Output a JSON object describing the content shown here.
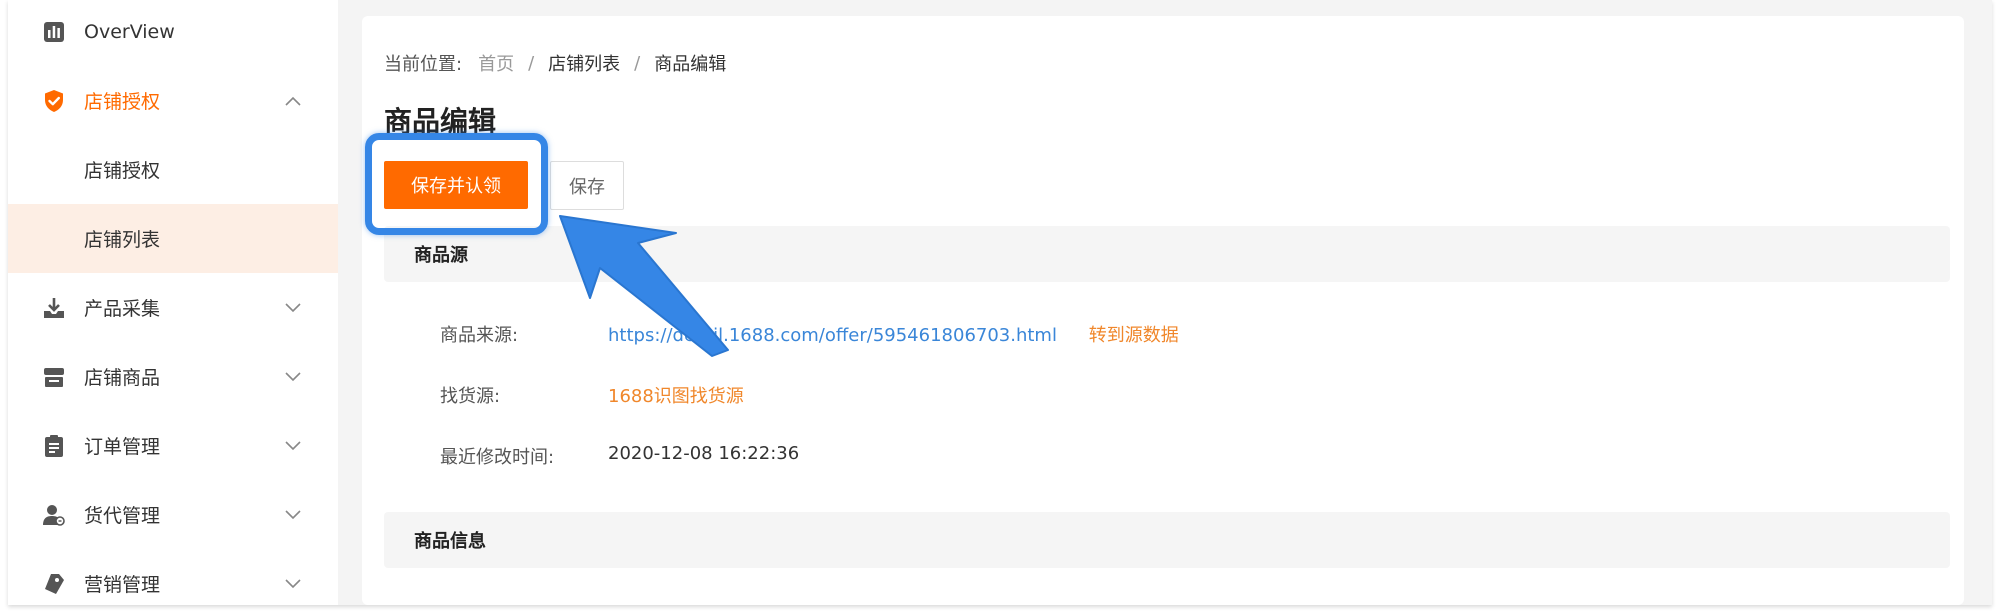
{
  "sidebar": {
    "items": [
      {
        "label": "OverView",
        "icon": "chart-bars-icon"
      },
      {
        "label": "店铺授权",
        "icon": "shield-check-icon"
      },
      {
        "label": "店铺授权",
        "icon": ""
      },
      {
        "label": "店铺列表",
        "icon": ""
      },
      {
        "label": "产品采集",
        "icon": "download-tray-icon"
      },
      {
        "label": "店铺商品",
        "icon": "store-icon"
      },
      {
        "label": "订单管理",
        "icon": "clipboard-icon"
      },
      {
        "label": "货代管理",
        "icon": "user-agent-icon"
      },
      {
        "label": "营销管理",
        "icon": "tag-icon"
      }
    ],
    "accent": "#ff6a00",
    "selected_bg": "#fdeee4"
  },
  "breadcrumb": {
    "prefix": "当前位置:",
    "items": [
      "首页",
      "店铺列表",
      "商品编辑"
    ],
    "separator": "/"
  },
  "page": {
    "title": "商品编辑"
  },
  "actions": {
    "primary_label": "保存并认领",
    "secondary_label": "保存"
  },
  "sections": {
    "source": {
      "title": "商品源",
      "fields": {
        "source_label": "商品来源:",
        "source_url": "https://detail.1688.com/offer/595461806703.html",
        "source_action": "转到源数据",
        "find_label": "找货源:",
        "find_link": "1688识图找货源",
        "modified_label": "最近修改时间:",
        "modified_value": "2020-12-08 16:22:36"
      }
    },
    "info": {
      "title": "商品信息"
    }
  },
  "annotation": {
    "color": "#3586e6"
  }
}
